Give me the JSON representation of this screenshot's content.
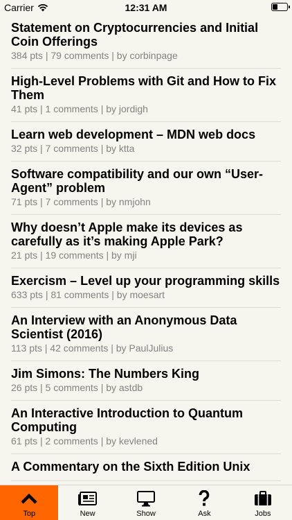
{
  "status_bar": {
    "carrier": "Carrier",
    "time": "12:31 AM",
    "battery_level": 0.35
  },
  "stories": [
    {
      "title": "Statement on Cryptocurrencies and Initial Coin Offerings",
      "meta": "384 pts | 79 comments | by corbinpage"
    },
    {
      "title": "High-Level Problems with Git and How to Fix Them",
      "meta": "41 pts | 1 comments | by jordigh"
    },
    {
      "title": "Learn web development – MDN web docs",
      "meta": "32 pts | 7 comments | by ktta"
    },
    {
      "title": "Software compatibility and our own “User-Agent” problem",
      "meta": "71 pts | 7 comments | by nmjohn"
    },
    {
      "title": "Why doesn’t Apple make its devices as carefully as it’s making Apple Park?",
      "meta": "21 pts | 19 comments | by mji"
    },
    {
      "title": "Exercism – Level up your programming skills",
      "meta": "633 pts | 81 comments | by moesart"
    },
    {
      "title": "An Interview with an Anonymous Data Scientist (2016)",
      "meta": "113 pts | 42 comments | by PaulJulius"
    },
    {
      "title": "Jim Simons: The Numbers King",
      "meta": "26 pts | 5 comments | by astdb"
    },
    {
      "title": "An Interactive Introduction to Quantum Computing",
      "meta": "61 pts | 2 comments | by kevlened"
    },
    {
      "title": "A Commentary on the Sixth Edition Unix",
      "meta": ""
    }
  ],
  "tabs": [
    {
      "label": "Top",
      "icon": "chevron-up-icon",
      "active": true
    },
    {
      "label": "New",
      "icon": "newspaper-icon",
      "active": false
    },
    {
      "label": "Show",
      "icon": "monitor-icon",
      "active": false
    },
    {
      "label": "Ask",
      "icon": "question-icon",
      "active": false
    },
    {
      "label": "Jobs",
      "icon": "briefcase-icon",
      "active": false
    }
  ],
  "colors": {
    "accent": "#ff6600",
    "background": "#f6f6ef",
    "meta_text": "#828282"
  }
}
